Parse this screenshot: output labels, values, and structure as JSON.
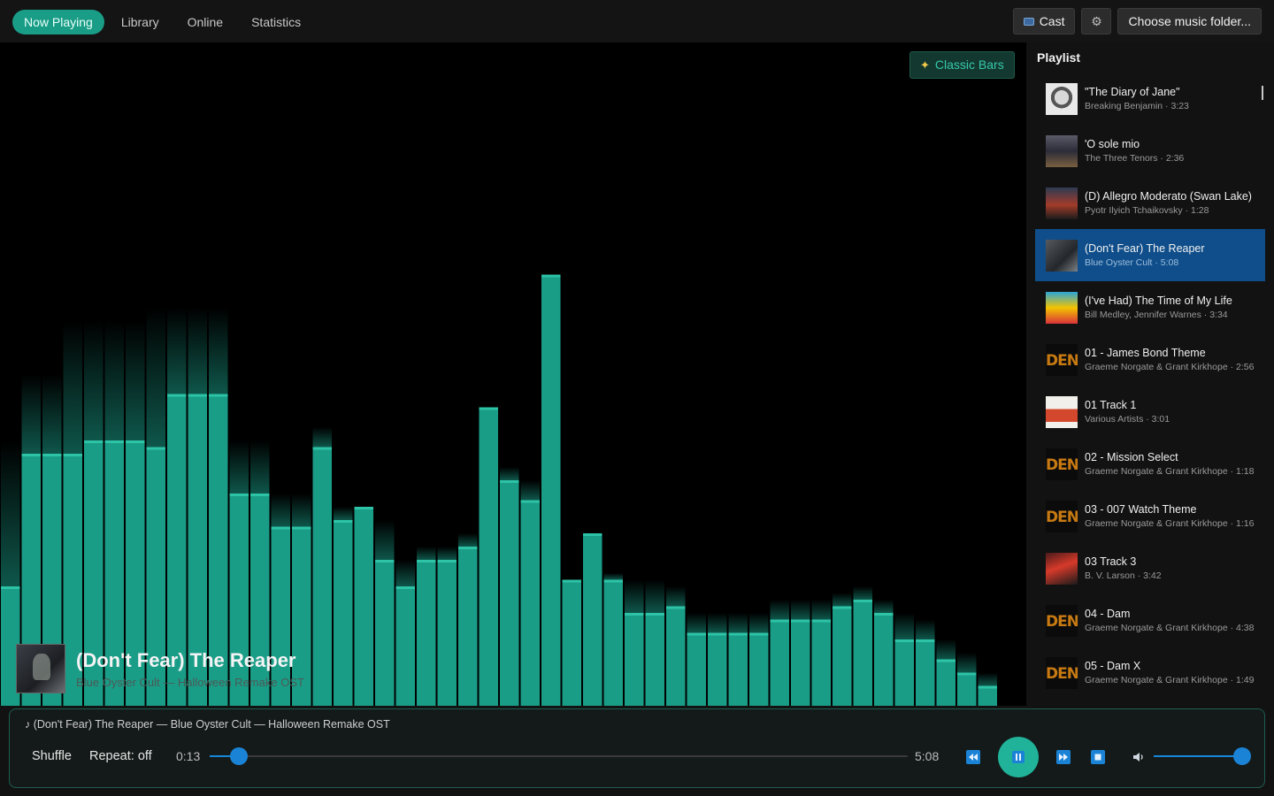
{
  "nav": {
    "tabs": [
      {
        "label": "Now Playing",
        "active": true
      },
      {
        "label": "Library"
      },
      {
        "label": "Online"
      },
      {
        "label": "Statistics"
      }
    ],
    "cast_label": "Cast",
    "cast_icon": "cast-icon",
    "settings_icon": "gear-icon",
    "folder_label": "Choose music folder..."
  },
  "visualizer": {
    "mode_label": "Classic Bars",
    "mode_icon": "sparkles-icon",
    "accent_color": "#1a9d87",
    "bar_levels": [
      0.18,
      0.38,
      0.38,
      0.38,
      0.4,
      0.4,
      0.4,
      0.39,
      0.47,
      0.47,
      0.47,
      0.32,
      0.32,
      0.27,
      0.27,
      0.39,
      0.28,
      0.3,
      0.22,
      0.18,
      0.22,
      0.22,
      0.24,
      0.45,
      0.34,
      0.31,
      0.65,
      0.19,
      0.26,
      0.19,
      0.14,
      0.14,
      0.15,
      0.11,
      0.11,
      0.11,
      0.11,
      0.13,
      0.13,
      0.13,
      0.15,
      0.16,
      0.14,
      0.1,
      0.1,
      0.07,
      0.05,
      0.03
    ],
    "peak_levels": [
      0.4,
      0.5,
      0.5,
      0.58,
      0.58,
      0.58,
      0.58,
      0.6,
      0.6,
      0.6,
      0.6,
      0.4,
      0.4,
      0.32,
      0.32,
      0.42,
      0.3,
      0.3,
      0.28,
      0.22,
      0.24,
      0.24,
      0.26,
      0.45,
      0.36,
      0.34,
      0.65,
      0.19,
      0.26,
      0.2,
      0.19,
      0.19,
      0.18,
      0.14,
      0.14,
      0.14,
      0.14,
      0.16,
      0.16,
      0.16,
      0.17,
      0.18,
      0.16,
      0.14,
      0.13,
      0.1,
      0.08,
      0.05
    ]
  },
  "now_playing": {
    "title": "(Don't Fear) The Reaper",
    "subtitle": "Blue Oyster Cult — Halloween Remake OST"
  },
  "playlist": {
    "heading": "Playlist",
    "items": [
      {
        "title": "\"The Diary of Jane\"",
        "meta": "Breaking Benjamin · 3:23"
      },
      {
        "title": "'O sole mio",
        "meta": "The Three Tenors · 2:36"
      },
      {
        "title": "(D) Allegro Moderato (Swan Lake)",
        "meta": "Pyotr Ilyich Tchaikovsky · 1:28"
      },
      {
        "title": "(Don't Fear) The Reaper",
        "meta": "Blue Oyster Cult · 5:08",
        "active": true
      },
      {
        "title": "(I've Had) The Time of My Life",
        "meta": "Bill Medley, Jennifer Warnes · 3:34"
      },
      {
        "title": "01 - James Bond Theme",
        "meta": "Graeme Norgate & Grant Kirkhope · 2:56"
      },
      {
        "title": "01 Track 1",
        "meta": "Various Artists · 3:01"
      },
      {
        "title": "02 - Mission Select",
        "meta": "Graeme Norgate & Grant Kirkhope · 1:18"
      },
      {
        "title": "03 - 007 Watch Theme",
        "meta": "Graeme Norgate & Grant Kirkhope · 1:16"
      },
      {
        "title": "03 Track 3",
        "meta": "B. V. Larson · 3:42"
      },
      {
        "title": "04 - Dam",
        "meta": "Graeme Norgate & Grant Kirkhope · 4:38"
      },
      {
        "title": "05 - Dam X",
        "meta": "Graeme Norgate & Grant Kirkhope · 1:49"
      }
    ],
    "dem_art_text": "DEN"
  },
  "player": {
    "now_line": "♪ (Don't Fear) The Reaper — Blue Oyster Cult — Halloween Remake OST",
    "shuffle_label": "Shuffle",
    "repeat_label": "Repeat: off",
    "elapsed": "0:13",
    "duration": "5:08",
    "progress": 0.042,
    "volume": 1.0,
    "prev_icon": "skip-back-icon",
    "pause_icon": "pause-icon",
    "next_icon": "skip-forward-icon",
    "stop_icon": "stop-icon",
    "volume_icon": "volume-icon"
  }
}
